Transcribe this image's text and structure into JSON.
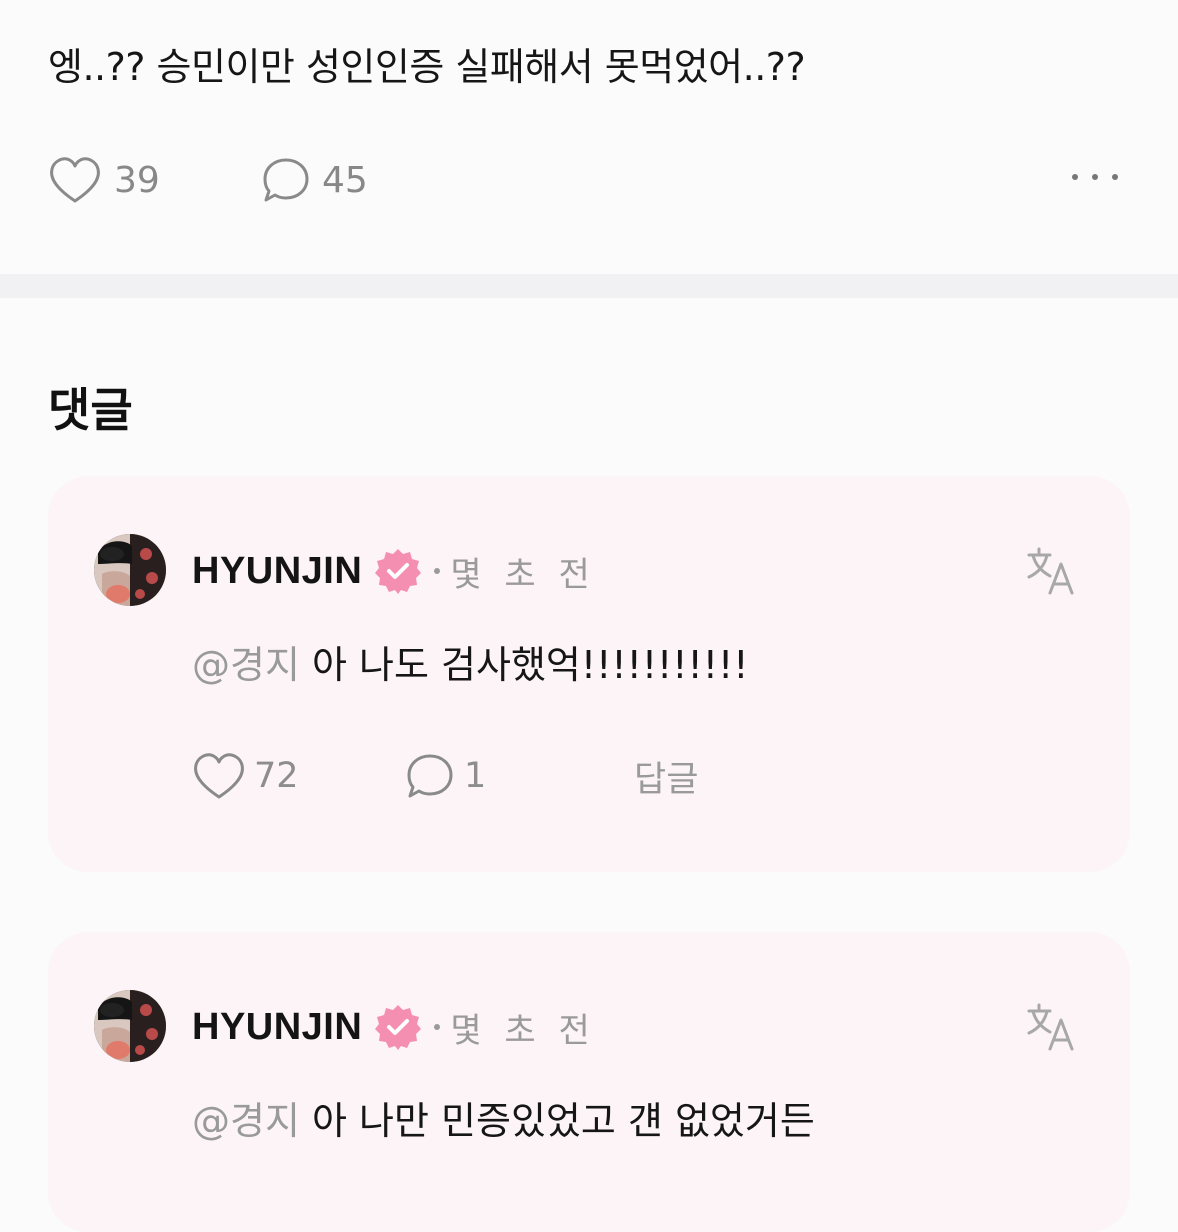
{
  "post": {
    "text": "엥..?? 승민이만 성인인증 실패해서 못먹었어..??",
    "likes": "39",
    "comments": "45"
  },
  "comments_section": {
    "title": "댓글",
    "items": [
      {
        "author": "HYUNJIN",
        "time": "몇 초 전",
        "mention": "@경지",
        "text": "아 나도 검사했억!!!!!!!!!!!",
        "likes": "72",
        "replies": "1",
        "reply_label": "답글"
      },
      {
        "author": "HYUNJIN",
        "time": "몇 초 전",
        "mention": "@경지",
        "text": "아 나만 민증있었고 걘 없었거든"
      }
    ]
  },
  "colors": {
    "accent_verified": "#f48fb1",
    "card_background": "#fcf4f6",
    "muted_text": "#9a9a9a"
  },
  "icons": [
    "heart-icon",
    "comment-bubble-icon",
    "more-icon",
    "verified-badge-icon",
    "translate-icon"
  ]
}
